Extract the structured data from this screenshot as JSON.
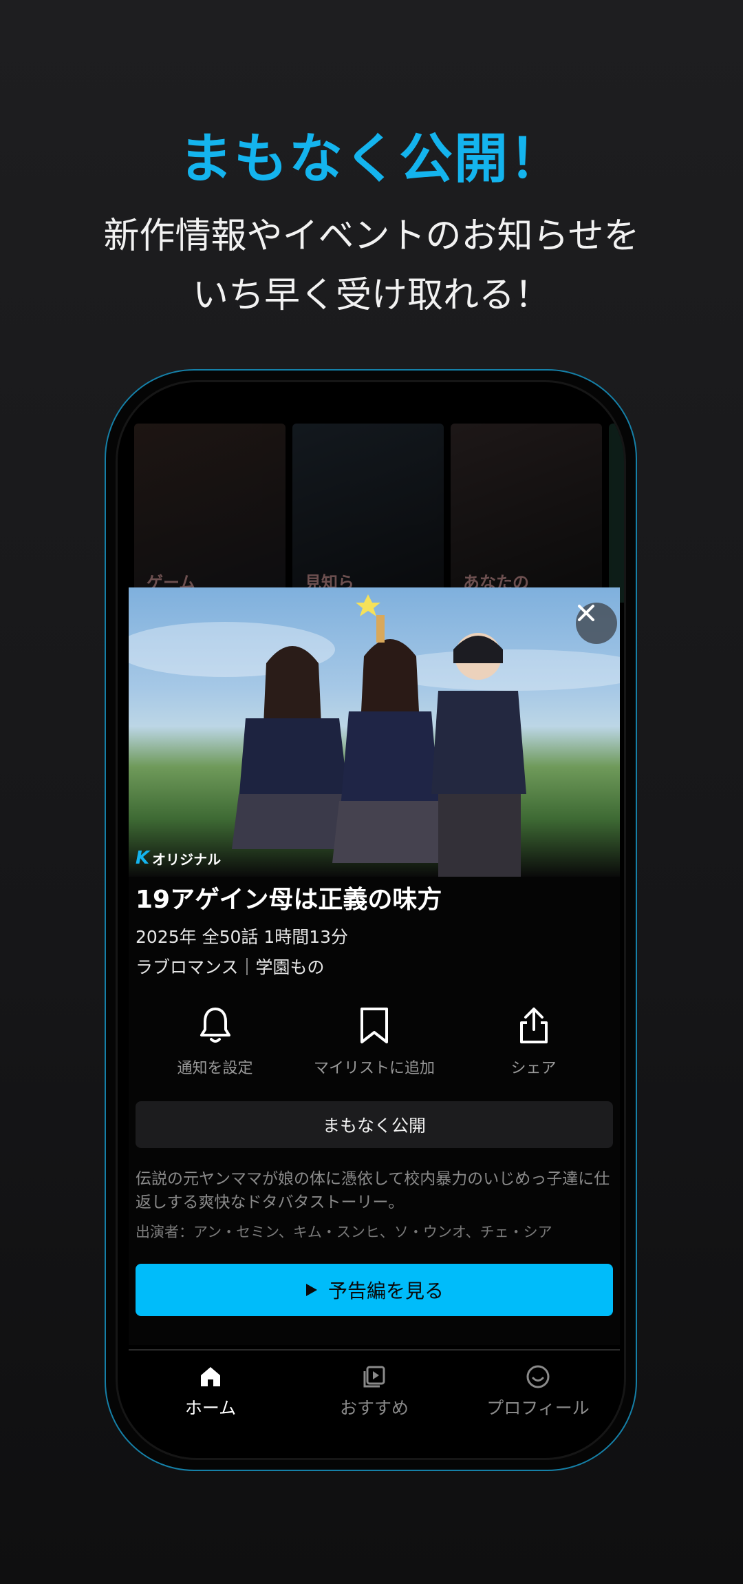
{
  "promo": {
    "title": "まもなく公開！",
    "subtitle_line1": "新作情報やイベントのお知らせを",
    "subtitle_line2": "いち早く受け取れる！"
  },
  "background_rows": [
    "ゲーム",
    "見知ら",
    "あなたの"
  ],
  "modal": {
    "badge_mark": "K",
    "badge_text": "オリジナル",
    "title": "19アゲイン母は正義の味方",
    "meta": "2025年  全50話  1時間13分",
    "genre": "ラブロマンス｜学園もの",
    "actions": [
      {
        "icon": "bell-icon",
        "label": "通知を設定"
      },
      {
        "icon": "bookmark-icon",
        "label": "マイリストに追加"
      },
      {
        "icon": "share-icon",
        "label": "シェア"
      }
    ],
    "coming_soon": "まもなく公開",
    "description": "伝説の元ヤンママが娘の体に憑依して校内暴力のいじめっ子達に仕返しする爽快なドタバタストーリー。",
    "cast": "出演者：アン・セミン、キム・スンヒ、ソ・ウンオ、チェ・シア",
    "trailer_label": "予告編を見る"
  },
  "tabs": [
    {
      "icon": "home-icon",
      "label": "ホーム",
      "active": true
    },
    {
      "icon": "recommend-icon",
      "label": "おすすめ",
      "active": false
    },
    {
      "icon": "profile-icon",
      "label": "プロフィール",
      "active": false
    }
  ],
  "colors": {
    "accent": "#14b4ee",
    "button": "#00bcfa",
    "background": "#1b1b1d"
  }
}
